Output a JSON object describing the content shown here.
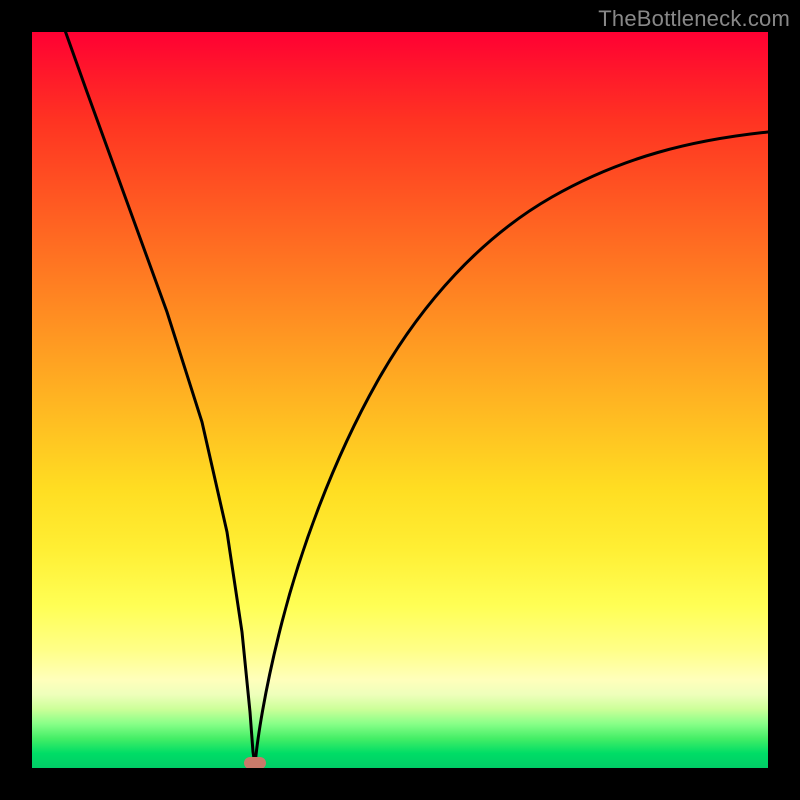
{
  "watermark": {
    "text": "TheBottleneck.com"
  },
  "chart_data": {
    "type": "line",
    "title": "",
    "xlabel": "",
    "ylabel": "",
    "xlim": [
      0,
      100
    ],
    "ylim": [
      0,
      100
    ],
    "series": [
      {
        "name": "left-branch",
        "x": [
          0,
          4,
          8,
          12,
          16,
          20,
          24,
          27,
          28.5
        ],
        "y": [
          100,
          86,
          71,
          57,
          43,
          29,
          14,
          3,
          0
        ]
      },
      {
        "name": "right-branch",
        "x": [
          28.5,
          30,
          33,
          37,
          42,
          48,
          55,
          63,
          72,
          82,
          92,
          100
        ],
        "y": [
          0,
          6,
          18,
          32,
          45,
          56,
          64,
          70,
          74,
          77,
          79,
          80
        ]
      }
    ],
    "annotations": [
      {
        "name": "min-marker",
        "x": 28.5,
        "y": 0
      }
    ],
    "background": "rainbow-vertical-gradient"
  }
}
